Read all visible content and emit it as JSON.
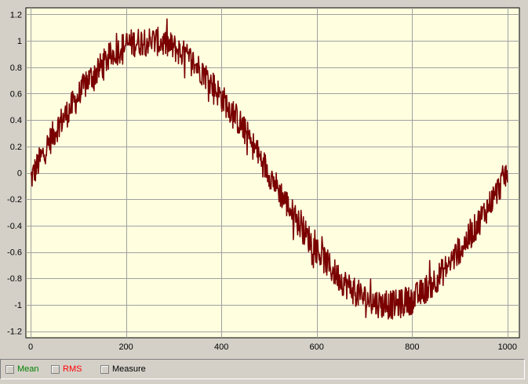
{
  "chart_data": {
    "type": "line",
    "x_ticks": [
      0,
      200,
      400,
      600,
      800,
      1000
    ],
    "y_ticks": [
      "1.2",
      "1",
      "0.8",
      "0.6",
      "0.4",
      "0.2",
      "0",
      "-0.2",
      "-0.4",
      "-0.6",
      "-0.8",
      "-1",
      "-1.2"
    ],
    "xlim": [
      -10,
      1025
    ],
    "ylim": [
      -1.25,
      1.25
    ],
    "grid": true,
    "legend": "bottom",
    "series": [
      {
        "color": "#7a0000",
        "x": [
          0,
          20,
          40,
          60,
          80,
          100,
          120,
          140,
          160,
          180,
          200,
          220,
          240,
          260,
          280,
          300,
          320,
          340,
          360,
          380,
          400,
          420,
          440,
          460,
          480,
          500,
          520,
          540,
          560,
          580,
          600,
          620,
          640,
          660,
          680,
          700,
          720,
          740,
          760,
          780,
          800,
          820,
          840,
          860,
          880,
          900,
          920,
          940,
          960,
          980,
          1000
        ],
        "y": [
          -0.05,
          0.1,
          0.24,
          0.37,
          0.47,
          0.58,
          0.7,
          0.77,
          0.86,
          0.92,
          0.97,
          0.99,
          1.0,
          1.0,
          0.98,
          0.95,
          0.9,
          0.84,
          0.77,
          0.68,
          0.57,
          0.48,
          0.37,
          0.25,
          0.12,
          0.0,
          -0.13,
          -0.25,
          -0.37,
          -0.48,
          -0.58,
          -0.68,
          -0.77,
          -0.84,
          -0.9,
          -0.95,
          -0.98,
          -1.0,
          -1.0,
          -0.99,
          -0.96,
          -0.91,
          -0.84,
          -0.77,
          -0.68,
          -0.58,
          -0.49,
          -0.37,
          -0.25,
          -0.13,
          0.02
        ],
        "noise_amplitude": 0.11
      }
    ],
    "axis_color": "#000000",
    "grid_color": "#a0a0a0",
    "plot_background": "#ffffe0"
  },
  "legend": {
    "items": [
      {
        "label": "Mean",
        "color": "#008000"
      },
      {
        "label": "RMS",
        "color": "#ff0000"
      },
      {
        "label": "Measure",
        "color": "#000000"
      }
    ]
  }
}
